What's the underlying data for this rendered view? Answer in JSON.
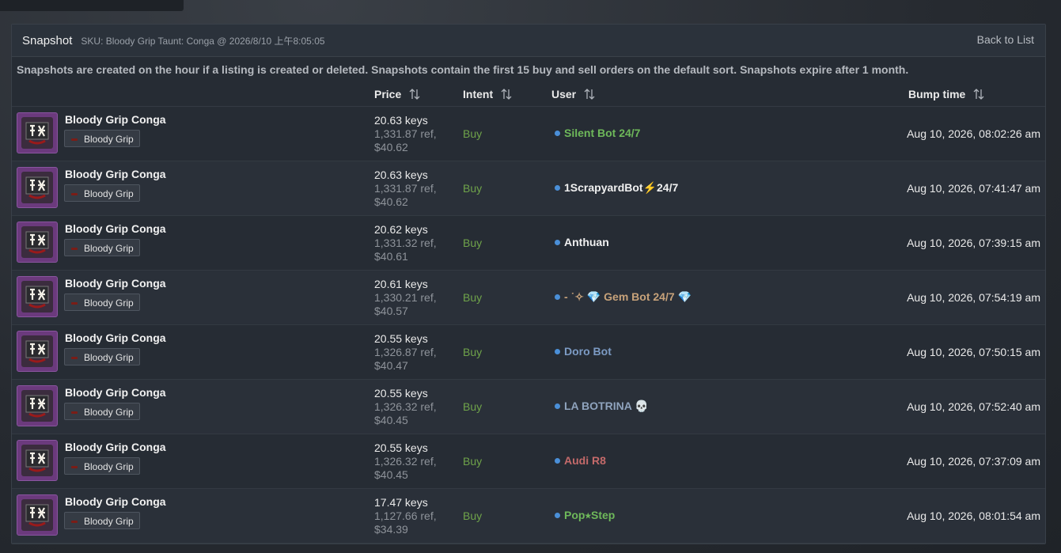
{
  "header": {
    "title": "Snapshot",
    "sku": "SKU: Bloody Grip Taunt: Conga @ 2026/8/10 上午8:05:05",
    "back_label": "Back to List"
  },
  "note": "Snapshots are created on the hour if a listing is created or deleted. Snapshots contain the first 15 buy and sell orders on the default sort. Snapshots expire after 1 month.",
  "columns": {
    "price": "Price",
    "intent": "Intent",
    "user": "User",
    "bump_time": "Bump time"
  },
  "colors": {
    "intent_buy": "#6fa34a",
    "status_online": "#4a8fd8"
  },
  "rows": [
    {
      "item": "Bloody Grip Conga",
      "paint": "Bloody Grip",
      "price_keys": "20.63 keys",
      "price_ref": "1,331.87 ref,",
      "price_usd": "$40.62",
      "intent": "Buy",
      "user": "Silent Bot 24/7",
      "user_color": "#6eb85a",
      "bump": "Aug 10, 2026, 08:02:26 am"
    },
    {
      "item": "Bloody Grip Conga",
      "paint": "Bloody Grip",
      "price_keys": "20.63 keys",
      "price_ref": "1,331.87 ref,",
      "price_usd": "$40.62",
      "intent": "Buy",
      "user": "1ScrapyardBot⚡24/7",
      "user_color": "#f0f0f0",
      "bump": "Aug 10, 2026, 07:41:47 am"
    },
    {
      "item": "Bloody Grip Conga",
      "paint": "Bloody Grip",
      "price_keys": "20.62 keys",
      "price_ref": "1,331.32 ref,",
      "price_usd": "$40.61",
      "intent": "Buy",
      "user": "Anthuan",
      "user_color": "#f0f0f0",
      "bump": "Aug 10, 2026, 07:39:15 am"
    },
    {
      "item": "Bloody Grip Conga",
      "paint": "Bloody Grip",
      "price_keys": "20.61 keys",
      "price_ref": "1,330.21 ref,",
      "price_usd": "$40.57",
      "intent": "Buy",
      "user": "- ˙✧ 💎 Gem Bot 24/7 💎",
      "user_color": "#c7a27a",
      "bump": "Aug 10, 2026, 07:54:19 am"
    },
    {
      "item": "Bloody Grip Conga",
      "paint": "Bloody Grip",
      "price_keys": "20.55 keys",
      "price_ref": "1,326.87 ref,",
      "price_usd": "$40.47",
      "intent": "Buy",
      "user": "Doro Bot",
      "user_color": "#7c9bc4",
      "bump": "Aug 10, 2026, 07:50:15 am"
    },
    {
      "item": "Bloody Grip Conga",
      "paint": "Bloody Grip",
      "price_keys": "20.55 keys",
      "price_ref": "1,326.32 ref,",
      "price_usd": "$40.45",
      "intent": "Buy",
      "user": "LA BOTRINA 💀",
      "user_color": "#8fa3bd",
      "bump": "Aug 10, 2026, 07:52:40 am"
    },
    {
      "item": "Bloody Grip Conga",
      "paint": "Bloody Grip",
      "price_keys": "20.55 keys",
      "price_ref": "1,326.32 ref,",
      "price_usd": "$40.45",
      "intent": "Buy",
      "user": "Audi R8",
      "user_color": "#c46a6a",
      "bump": "Aug 10, 2026, 07:37:09 am"
    },
    {
      "item": "Bloody Grip Conga",
      "paint": "Bloody Grip",
      "price_keys": "17.47 keys",
      "price_ref": "1,127.66 ref,",
      "price_usd": "$34.39",
      "intent": "Buy",
      "user": "Pop⭑Step",
      "user_color": "#6eb85a",
      "bump": "Aug 10, 2026, 08:01:54 am"
    }
  ]
}
